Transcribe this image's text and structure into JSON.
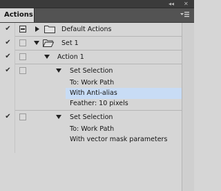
{
  "panel": {
    "tab_label": "Actions",
    "collapse_glyph": "◂◂",
    "close_glyph": "✕",
    "menu_icon": "panel-menu-icon"
  },
  "rows": {
    "default_actions": {
      "label": "Default Actions",
      "checked": "✔"
    },
    "set1": {
      "label": "Set 1",
      "checked": "✔"
    },
    "action1": {
      "label": "Action 1",
      "checked": "✔"
    },
    "set_selection_1": {
      "label": "Set Selection",
      "checked": "✔",
      "details": [
        "To: Work Path",
        "With Anti-alias",
        "Feather: 10 pixels"
      ]
    },
    "set_selection_2": {
      "label": "Set Selection",
      "checked": "✔",
      "selected": true,
      "details": [
        "To: Work Path",
        "With vector mask parameters"
      ]
    }
  },
  "colors": {
    "selection": "#c8dcf5",
    "panel_bg": "#d6d6d6",
    "header_bg": "#535353"
  }
}
